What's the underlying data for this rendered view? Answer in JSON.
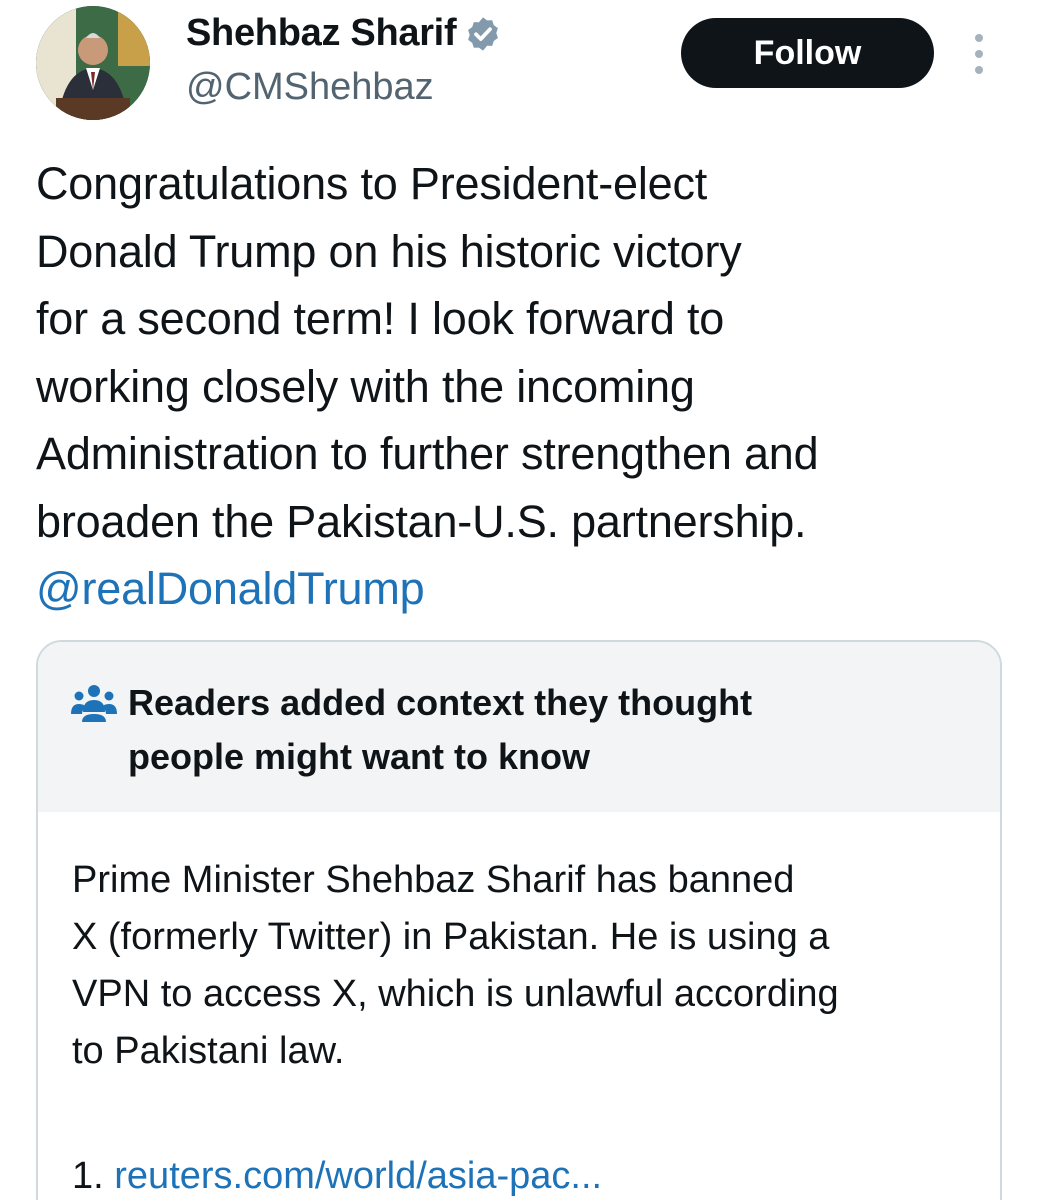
{
  "author": {
    "display_name": "Shehbaz Sharif",
    "handle": "@CMShehbaz",
    "verified": true,
    "avatar_icon": "profile-photo"
  },
  "actions": {
    "follow_label": "Follow",
    "more_icon": "more-vertical-icon"
  },
  "tweet": {
    "lines": [
      "Congratulations to President-elect",
      "Donald Trump on his historic victory",
      "for a second term! I look forward to",
      "working closely with the incoming",
      "Administration to further strengthen and",
      "broaden the Pakistan-U.S. partnership."
    ],
    "mention": "@realDonaldTrump"
  },
  "community_note": {
    "icon": "people-icon",
    "title_lines": [
      "Readers added context they thought",
      "people might want to know"
    ],
    "body_lines": [
      "Prime Minister Shehbaz Sharif has banned",
      "X (formerly Twitter) in Pakistan. He is using a",
      "VPN to access X, which is unlawful according",
      "to Pakistani law."
    ],
    "sources": [
      {
        "number": "1.",
        "link": "reuters.com/world/asia-pac..."
      }
    ]
  },
  "colors": {
    "text": "#0f1419",
    "secondary": "#536471",
    "link": "#1d72b8",
    "follow_bg": "#0f1419",
    "note_header_bg": "#f3f4f5",
    "border": "#cfd9de",
    "verified_badge": "#829aab"
  }
}
